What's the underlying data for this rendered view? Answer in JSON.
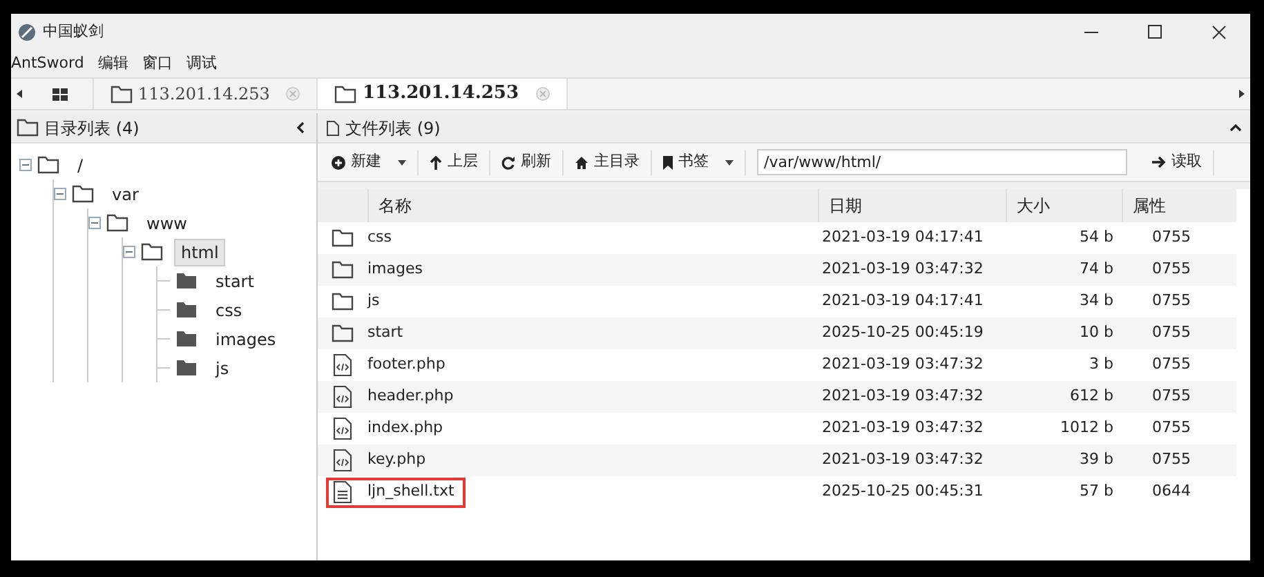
{
  "window": {
    "title": "中国蚁剑"
  },
  "menu": [
    "AntSword",
    "编辑",
    "窗口",
    "调试"
  ],
  "tabs": [
    {
      "label": "113.201.14.253",
      "selected": false
    },
    {
      "label": "113.201.14.253",
      "selected": true
    }
  ],
  "tree_panel": {
    "title": "目录列表 (4)",
    "tree": [
      {
        "label": "/",
        "expanded": true,
        "selected": false,
        "children": [
          {
            "label": "var",
            "expanded": true,
            "selected": false,
            "children": [
              {
                "label": "www",
                "expanded": true,
                "selected": false,
                "children": [
                  {
                    "label": "html",
                    "expanded": true,
                    "selected": true,
                    "children": [
                      {
                        "label": "start",
                        "selected": false
                      },
                      {
                        "label": "css",
                        "selected": false
                      },
                      {
                        "label": "images",
                        "selected": false
                      },
                      {
                        "label": "js",
                        "selected": false
                      }
                    ]
                  }
                ]
              }
            ]
          }
        ]
      }
    ]
  },
  "file_panel": {
    "title": "文件列表 (9)",
    "toolbar": {
      "new": "新建",
      "up": "上层",
      "refresh": "刷新",
      "home": "主目录",
      "bookmarks": "书签",
      "path": "/var/www/html/",
      "read": "读取"
    },
    "table": {
      "columns": [
        "名称",
        "日期",
        "大小",
        "属性"
      ],
      "rows": [
        {
          "kind": "folder",
          "name": "css",
          "date": "2021-03-19 04:17:41",
          "size": "54 b",
          "mode": "0755",
          "highlighted": false
        },
        {
          "kind": "folder",
          "name": "images",
          "date": "2021-03-19 03:47:32",
          "size": "74 b",
          "mode": "0755",
          "highlighted": false
        },
        {
          "kind": "folder",
          "name": "js",
          "date": "2021-03-19 04:17:41",
          "size": "34 b",
          "mode": "0755",
          "highlighted": false
        },
        {
          "kind": "folder",
          "name": "start",
          "date": "2025-10-25 00:45:19",
          "size": "10 b",
          "mode": "0755",
          "highlighted": false
        },
        {
          "kind": "code",
          "name": "footer.php",
          "date": "2021-03-19 03:47:32",
          "size": "3 b",
          "mode": "0755",
          "highlighted": false
        },
        {
          "kind": "code",
          "name": "header.php",
          "date": "2021-03-19 03:47:32",
          "size": "612 b",
          "mode": "0755",
          "highlighted": false
        },
        {
          "kind": "code",
          "name": "index.php",
          "date": "2021-03-19 03:47:32",
          "size": "1012 b",
          "mode": "0755",
          "highlighted": false
        },
        {
          "kind": "code",
          "name": "key.php",
          "date": "2021-03-19 03:47:32",
          "size": "39 b",
          "mode": "0755",
          "highlighted": false
        },
        {
          "kind": "text",
          "name": "ljn_shell.txt",
          "date": "2025-10-25 00:45:31",
          "size": "57 b",
          "mode": "0644",
          "highlighted": true
        }
      ]
    }
  }
}
